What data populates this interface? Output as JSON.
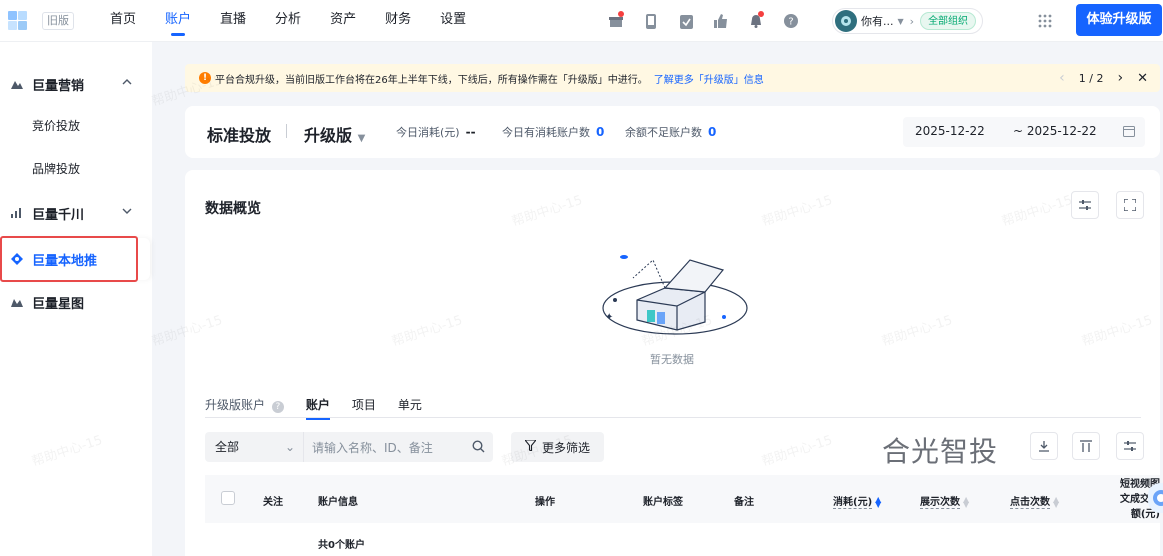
{
  "topbar": {
    "old_version_tag": "旧版",
    "nav": [
      "首页",
      "账户",
      "直播",
      "分析",
      "资产",
      "财务",
      "设置"
    ],
    "active_nav": "账户",
    "account_name": "你有...",
    "org_tag": "全部组织",
    "upgrade_button": "体验升级版"
  },
  "sidebar": {
    "groups": [
      {
        "label": "巨量营销",
        "expanded": true,
        "items": [
          "竞价投放",
          "品牌投放"
        ]
      },
      {
        "label": "巨量千川",
        "expanded": false
      },
      {
        "label": "巨量本地推",
        "active": true
      },
      {
        "label": "巨量星图"
      }
    ]
  },
  "notice": {
    "text": "平台合规升级，当前旧版工作台将在26年上半年下线，下线后，所有操作需在「升级版」中进行。",
    "link": "了解更多「升级版」信息",
    "pager": "1 / 2"
  },
  "header": {
    "title": "标准投放",
    "version": "升级版",
    "stats": [
      {
        "label": "今日消耗(元)",
        "value": "--"
      },
      {
        "label": "今日有消耗账户数",
        "value": "0"
      },
      {
        "label": "余额不足账户数",
        "value": "0"
      }
    ],
    "date_start": "2025-12-22",
    "date_end": "~ 2025-12-22"
  },
  "main": {
    "section_title": "数据概览",
    "empty_text": "暂无数据",
    "tabs_label": "升级版账户",
    "tabs": [
      "账户",
      "项目",
      "单元"
    ],
    "active_tab": "账户",
    "filter_select": "全部",
    "search_placeholder": "请输入名称、ID、备注",
    "more_filter": "更多筛选",
    "brand_watermark": "合光智投",
    "columns": {
      "follow": "关注",
      "account_info": "账户信息",
      "actions": "操作",
      "account_tag": "账户标签",
      "remark": "备注",
      "cost": "消耗(元)",
      "impressions": "展示次数",
      "clicks": "点击次数",
      "short_video_l1": "短视频图",
      "short_video_l2": "文成交金",
      "short_video_l3": "额(元)"
    },
    "total_accounts": "共0个账户"
  },
  "watermark_text": "帮助中心-15",
  "colors": {
    "primary": "#1664ff",
    "highlight_border": "#e84a4a",
    "notice_bg": "#fff8e3"
  }
}
